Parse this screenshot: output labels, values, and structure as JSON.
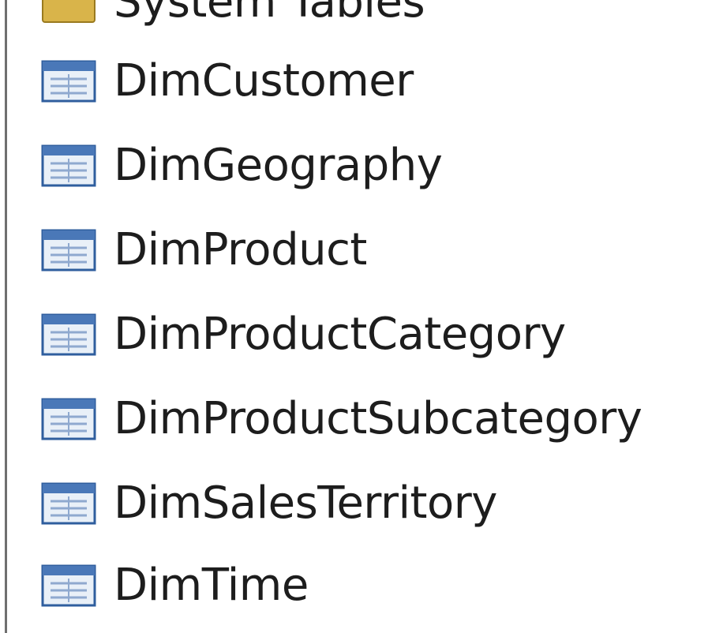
{
  "tree": {
    "partial_top_item": {
      "label": "System Tables",
      "icon": "folder-icon"
    },
    "items": [
      {
        "label": "DimCustomer",
        "icon": "table-icon"
      },
      {
        "label": "DimGeography",
        "icon": "table-icon"
      },
      {
        "label": "DimProduct",
        "icon": "table-icon"
      },
      {
        "label": "DimProductCategory",
        "icon": "table-icon"
      },
      {
        "label": "DimProductSubcategory",
        "icon": "table-icon"
      },
      {
        "label": "DimSalesTerritory",
        "icon": "table-icon"
      },
      {
        "label": "DimTime",
        "icon": "table-icon"
      }
    ]
  },
  "colors": {
    "icon_header": "#4a78b8",
    "icon_body": "#e9f0f8",
    "icon_border": "#2f5e9e",
    "folder": "#d9b44a",
    "text": "#1d1d1d"
  }
}
